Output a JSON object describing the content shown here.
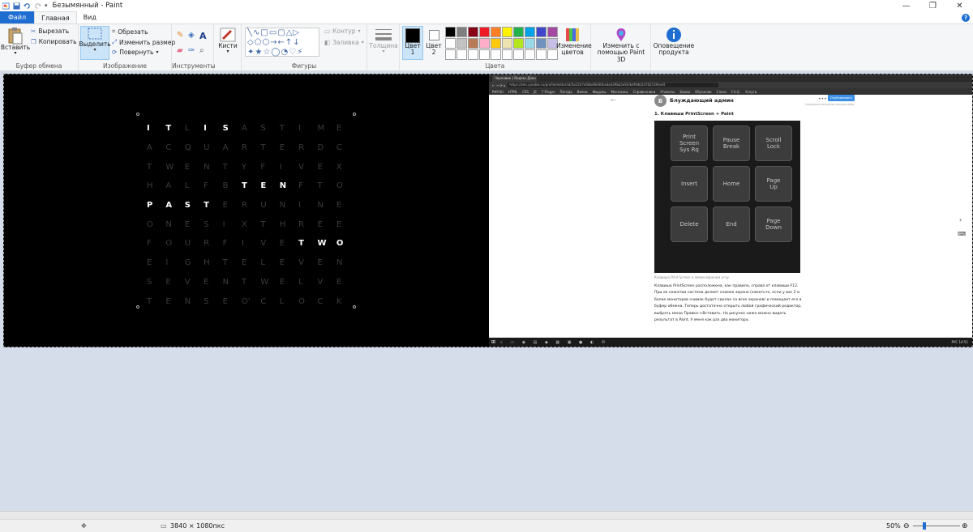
{
  "window": {
    "title": "Безымянный - Paint",
    "controls": [
      "—",
      "❐",
      "✕"
    ]
  },
  "tabs": [
    {
      "label": "Файл"
    },
    {
      "label": "Главная"
    },
    {
      "label": "Вид"
    }
  ],
  "ribbon": {
    "clipboard": {
      "paste": "Вставить",
      "cut": "Вырезать",
      "copy": "Копировать",
      "label": "Буфер обмена"
    },
    "image": {
      "select": "Выделить",
      "crop": "Обрезать",
      "resize": "Изменить размер",
      "rotate": "Повернуть",
      "label": "Изображение"
    },
    "tools": {
      "label": "Инструменты"
    },
    "brushes": {
      "label": "Кисти"
    },
    "shapes": {
      "outline": "Контур",
      "fill": "Заливка",
      "label": "Фигуры"
    },
    "size": {
      "label": "Толщина"
    },
    "colors": {
      "color1": "Цвет\n1",
      "color2": "Цвет\n2",
      "edit": "Изменение цветов",
      "label": "Цвета",
      "palette": [
        "#000000",
        "#7f7f7f",
        "#880015",
        "#ed1c24",
        "#ff7f27",
        "#fff200",
        "#22b14c",
        "#00a2e8",
        "#3f48cc",
        "#a349a4",
        "#ffffff",
        "#c3c3c3",
        "#b97a57",
        "#ffaec9",
        "#ffc90e",
        "#efe4b0",
        "#b5e61d",
        "#99d9ea",
        "#7092be",
        "#c8bfe7",
        "#ffffff",
        "#ffffff",
        "#ffffff",
        "#ffffff",
        "#ffffff",
        "#ffffff",
        "#ffffff",
        "#ffffff",
        "#ffffff",
        "#ffffff"
      ],
      "color1_value": "#000000",
      "color2_value": "#ffffff"
    },
    "paint3d": "Изменить с помощью Paint 3D",
    "notify": "Оповещение продукта"
  },
  "word_clock": {
    "rows": [
      [
        "I",
        "T",
        "L",
        "I",
        "S",
        "A",
        "S",
        "T",
        "I",
        "M",
        "E"
      ],
      [
        "A",
        "C",
        "Q",
        "U",
        "A",
        "R",
        "T",
        "E",
        "R",
        "D",
        "C"
      ],
      [
        "T",
        "W",
        "E",
        "N",
        "T",
        "Y",
        "F",
        "I",
        "V",
        "E",
        "X"
      ],
      [
        "H",
        "A",
        "L",
        "F",
        "B",
        "T",
        "E",
        "N",
        "F",
        "T",
        "O"
      ],
      [
        "P",
        "A",
        "S",
        "T",
        "E",
        "R",
        "U",
        "N",
        "I",
        "N",
        "E"
      ],
      [
        "O",
        "N",
        "E",
        "S",
        "I",
        "X",
        "T",
        "H",
        "R",
        "E",
        "E"
      ],
      [
        "F",
        "O",
        "U",
        "R",
        "F",
        "I",
        "V",
        "E",
        "T",
        "W",
        "O"
      ],
      [
        "E",
        "I",
        "G",
        "H",
        "T",
        "E",
        "L",
        "E",
        "V",
        "E",
        "N"
      ],
      [
        "S",
        "E",
        "V",
        "E",
        "N",
        "T",
        "W",
        "E",
        "L",
        "V",
        "E"
      ],
      [
        "T",
        "E",
        "N",
        "S",
        "E",
        "O'",
        "C",
        "L",
        "O",
        "C",
        "K"
      ]
    ],
    "lit": [
      [
        0,
        0
      ],
      [
        0,
        1
      ],
      [
        0,
        3
      ],
      [
        0,
        4
      ],
      [
        3,
        5
      ],
      [
        3,
        6
      ],
      [
        3,
        7
      ],
      [
        4,
        0
      ],
      [
        4,
        1
      ],
      [
        4,
        2
      ],
      [
        4,
        3
      ],
      [
        6,
        8
      ],
      [
        6,
        9
      ],
      [
        6,
        10
      ]
    ]
  },
  "browser": {
    "tab_title": "Черновик | Яндекс.Дзен",
    "url": "https://zen.yandex.ru/profile/editor/id/5e2247e0dbd9d40hadad398a5e93/b4f9db54762539/edit",
    "bookmarks": [
      "PHP.SU",
      "HTML",
      "CSS",
      "JS",
      "7 Proger",
      "Погода",
      "Веяни",
      "Форумы",
      "Магазины",
      "Справочники",
      "Утилиты",
      "Банки",
      "Обучение",
      "Слоэз",
      "F.A.Q.",
      "Услуги"
    ],
    "channel_initial": "Б",
    "channel_name": "Блуждающий админ",
    "publish": "Опубликовать",
    "saved_note": "Сохранено несколько секунд назад",
    "heading": "1. Клавиша PrintScreen + Paint",
    "keys": [
      [
        "Print\nScreen\nSys Rq",
        "Pause\nBreak",
        "Scroll\nLock"
      ],
      [
        "Insert",
        "Home",
        "Page\nUp"
      ],
      [
        "Delete",
        "End",
        "Page\nDown"
      ]
    ],
    "caption": "Клавиша Print Screen в левом верхнем углу.",
    "body_text": "Клавиша PrintScreen расположена, как правило, справа от клавиши F12. При ее нажатии система делает снимок экрана (заметьте, если у вас 2 и более мониторов снимок будет сделан со всех экранов) и помещает его в буфер обмена. Теперь достаточно открыть любой графический редактор, выбрать меню Правка->Вставить. На рисунке ниже можно видеть результат в Paint. У меня как раз два монитора.",
    "tray": "РУС  14:51"
  },
  "status": {
    "dimensions": "3840 × 1080пкс",
    "zoom": "50%"
  }
}
